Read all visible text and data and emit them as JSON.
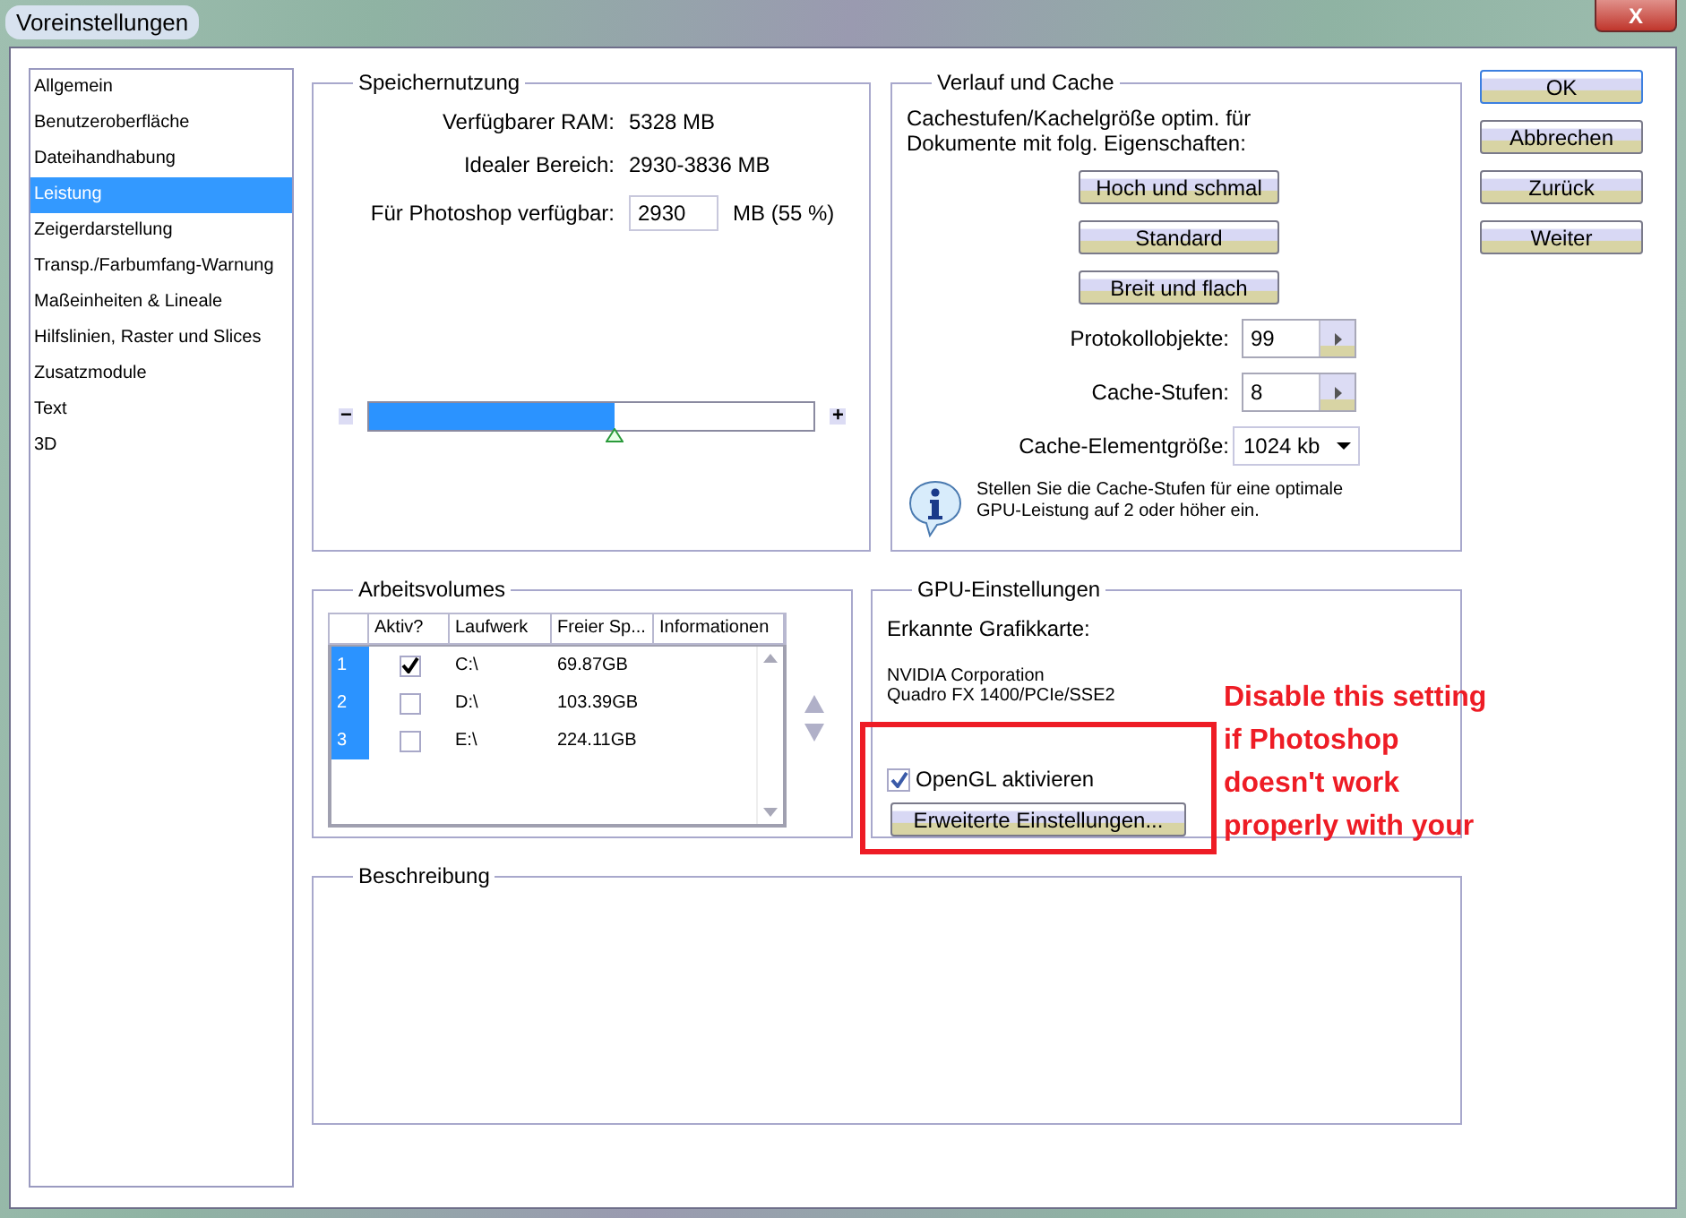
{
  "window": {
    "title": "Voreinstellungen",
    "close": "X"
  },
  "sidebar": {
    "items": [
      {
        "label": "Allgemein",
        "selected": false
      },
      {
        "label": "Benutzeroberfläche",
        "selected": false
      },
      {
        "label": "Dateihandhabung",
        "selected": false
      },
      {
        "label": "Leistung",
        "selected": true
      },
      {
        "label": "Zeigerdarstellung",
        "selected": false
      },
      {
        "label": "Transp./Farbumfang-Warnung",
        "selected": false
      },
      {
        "label": "Maßeinheiten & Lineale",
        "selected": false
      },
      {
        "label": "Hilfslinien, Raster und Slices",
        "selected": false
      },
      {
        "label": "Zusatzmodule",
        "selected": false
      },
      {
        "label": "Text",
        "selected": false
      },
      {
        "label": "3D",
        "selected": false
      }
    ]
  },
  "memory": {
    "title": "Speichernutzung",
    "rows": [
      {
        "label": "Verfügbarer RAM:",
        "value": "5328 MB"
      },
      {
        "label": "Idealer Bereich:",
        "value": "2930-3836 MB"
      }
    ],
    "available_label": "Für Photoshop verfügbar:",
    "available_value": "2930",
    "available_unit": "MB (55 %)",
    "slider": {
      "minus": "−",
      "plus": "+",
      "level": 0.55
    }
  },
  "history_cache": {
    "title": "Verlauf und Cache",
    "description": "Cachestufen/Kachelgröße optim. für\nDokumente mit folg. Eigenschaften:",
    "presets": [
      "Hoch und schmal",
      "Standard",
      "Breit und flach"
    ],
    "fields": [
      {
        "kind": "spinner",
        "label": "Protokollobjekte:",
        "value": "99"
      },
      {
        "kind": "spinner",
        "label": "Cache-Stufen:",
        "value": "8"
      },
      {
        "kind": "dropdown",
        "label": "Cache-Elementgröße:",
        "value": "1024 kb"
      }
    ],
    "hint": "Stellen Sie die Cache-Stufen für eine optimale\nGPU-Leistung auf 2 oder höher ein."
  },
  "scratch_disks": {
    "title": "Arbeitsvolumes",
    "columns": [
      "Aktiv?",
      "Laufwerk",
      "Freier Sp...",
      "Informationen"
    ],
    "rows": [
      {
        "number": "1",
        "active": true,
        "drive": "C:\\",
        "free": "69.87GB"
      },
      {
        "number": "2",
        "active": false,
        "drive": "D:\\",
        "free": "103.39GB"
      },
      {
        "number": "3",
        "active": false,
        "drive": "E:\\",
        "free": "224.11GB"
      }
    ]
  },
  "gpu": {
    "title": "GPU-Einstellungen",
    "detected_label": "Erkannte Grafikkarte:",
    "card": "NVIDIA Corporation\nQuadro FX 1400/PCIe/SSE2",
    "opengl": {
      "label": "OpenGL aktivieren",
      "checked": true
    },
    "advanced_button": "Erweiterte Einstellungen..."
  },
  "description": {
    "title": "Beschreibung"
  },
  "buttons": [
    {
      "label": "OK",
      "default": true
    },
    {
      "label": "Abbrechen",
      "default": false
    },
    {
      "label": "Zurück",
      "default": false
    },
    {
      "label": "Weiter",
      "default": false
    }
  ],
  "annotation": {
    "text": "Disable this setting\nif Photoshop\ndoesn't work\nproperly with your"
  }
}
